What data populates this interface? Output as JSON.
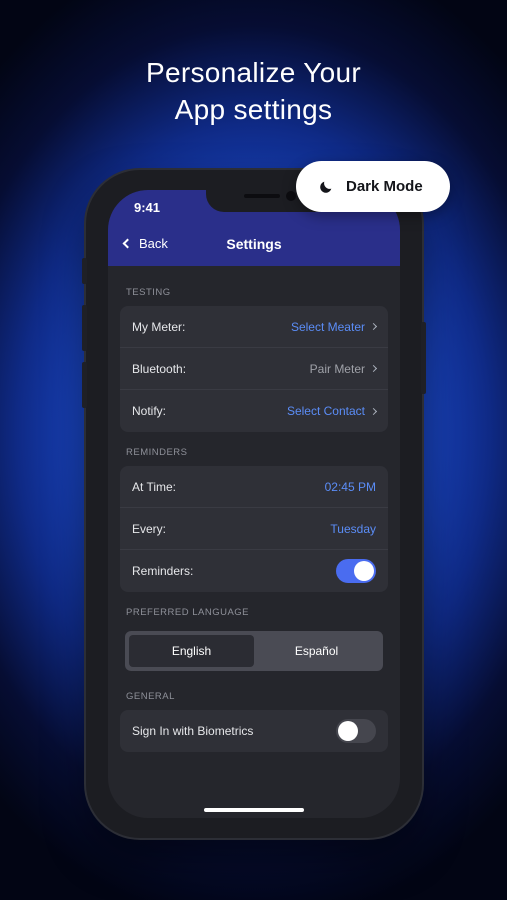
{
  "headline": {
    "line1": "Personalize Your",
    "line2": "App settings"
  },
  "badge": {
    "label": "Dark Mode",
    "icon": "moon-icon"
  },
  "status_bar": {
    "time": "9:41"
  },
  "nav": {
    "back_label": "Back",
    "title": "Settings"
  },
  "sections": {
    "testing": {
      "label": "TESTING",
      "rows": [
        {
          "label": "My Meter:",
          "value": "Select Meater"
        },
        {
          "label": "Bluetooth:",
          "value": "Pair Meter"
        },
        {
          "label": "Notify:",
          "value": "Select Contact"
        }
      ]
    },
    "reminders": {
      "label": "REMINDERS",
      "rows": [
        {
          "label": "At Time:",
          "value": "02:45 PM"
        },
        {
          "label": "Every:",
          "value": "Tuesday"
        },
        {
          "label": "Reminders:",
          "toggle": true
        }
      ]
    },
    "language": {
      "label": "PREFERRED LANGUAGE",
      "options": [
        "English",
        "Español"
      ],
      "selected": "English"
    },
    "general": {
      "label": "GENERAL",
      "rows": [
        {
          "label": "Sign In with Biometrics",
          "toggle": false
        }
      ]
    }
  },
  "colors": {
    "accent": "#5b8df7",
    "nav_bar": "#2a2f8a",
    "toggle_on": "#4a6cf0",
    "background_glow": "#2e6cf5"
  }
}
